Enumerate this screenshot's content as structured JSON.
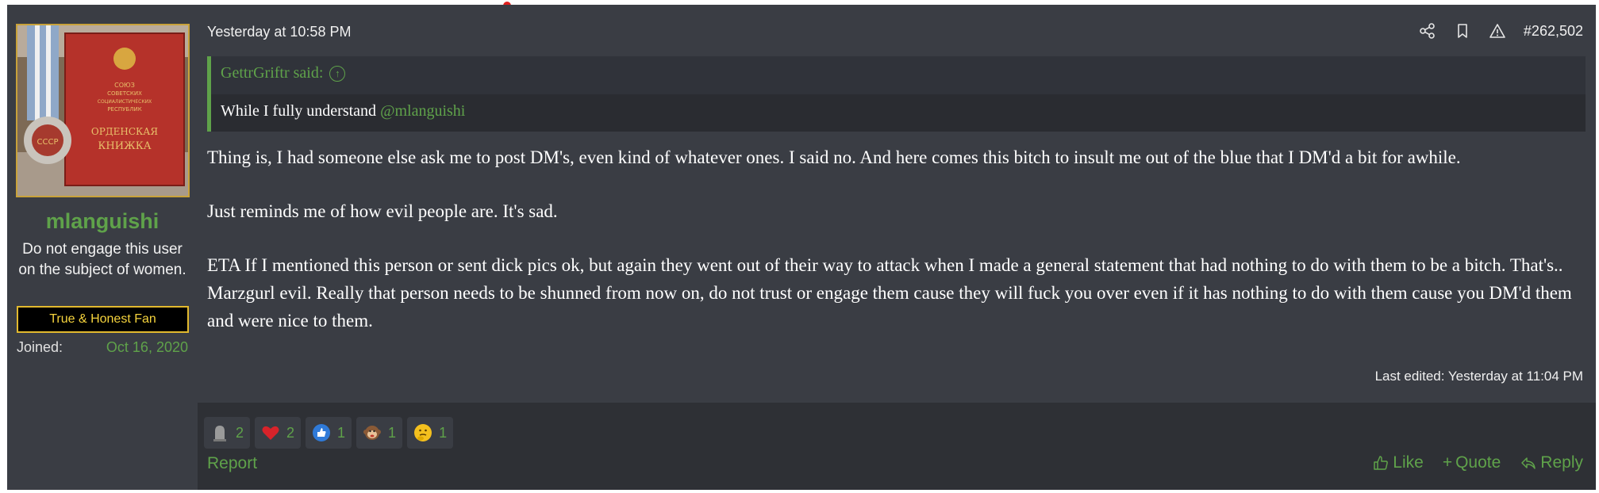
{
  "user": {
    "username": "mlanguishi",
    "user_title": "Do not engage this user on the subject of women.",
    "banner": "True & Honest Fan",
    "joined_label": "Joined:",
    "joined_value": "Oct 16, 2020",
    "avatar_text": [
      "СОЮЗ",
      "СОВЕТСКИХ",
      "СОЦИАЛИСТИЧЕСКИХ",
      "РЕСПУБЛИК",
      "ОРДЕНСКАЯ",
      "КНИЖКА",
      "СССР"
    ]
  },
  "post": {
    "date": "Yesterday at 10:58 PM",
    "number": "#262,502",
    "quote": {
      "author": "GettrGriftr said:",
      "text_before": "While I fully understand ",
      "mention": "@mlanguishi"
    },
    "paragraphs": [
      "Thing is, I had someone else ask me to post DM's, even kind of whatever ones. I said no. And here comes this bitch to insult me out of the blue that I DM'd a bit for awhile.",
      "Just reminds me of how evil people are. It's sad.",
      "ETA If I mentioned this person or sent dick pics ok, but again they went out of their way to attack when I made a general statement that had nothing to do with them to be a bitch. That's.. Marzgurl evil. Really that person needs to be shunned from now on, do not trust or engage them cause they will fuck you over even if it has nothing to do with them cause you DM'd them and were nice to them."
    ],
    "last_edited": "Last edited: Yesterday at 11:04 PM"
  },
  "reactions": [
    {
      "icon": "tombstone-icon",
      "count": "2"
    },
    {
      "icon": "heart-icon",
      "count": "2"
    },
    {
      "icon": "thumbs-up-icon",
      "count": "1"
    },
    {
      "icon": "monkey-icon",
      "count": "1"
    },
    {
      "icon": "thinking-face-icon",
      "count": "1"
    }
  ],
  "footer": {
    "report": "Report",
    "like": "Like",
    "quote": "Quote",
    "reply": "Reply"
  },
  "colors": {
    "accent": "#5fa24a",
    "banner_border": "#e2b92e",
    "background": "#3a3d44"
  }
}
